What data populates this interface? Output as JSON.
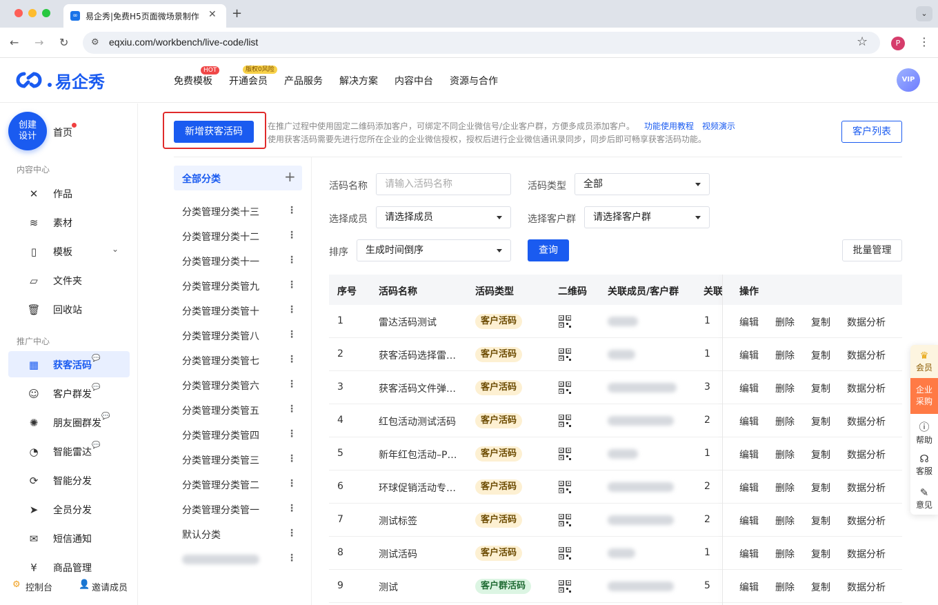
{
  "browser": {
    "tab_title": "易企秀|免费H5页面微场景制作",
    "tab_favicon": "∞",
    "url": "eqxiu.com/workbench/live-code/list",
    "profile_initial": "P"
  },
  "header": {
    "logo_text": "易企秀",
    "nav": [
      {
        "label": "免费模板",
        "badge": "HOT"
      },
      {
        "label": "开通会员",
        "badge": "版权0风险"
      },
      {
        "label": "产品服务",
        "badge": ""
      },
      {
        "label": "解决方案",
        "badge": ""
      },
      {
        "label": "内容中台",
        "badge": ""
      },
      {
        "label": "资源与合作",
        "badge": ""
      }
    ],
    "vip_label": "VIP"
  },
  "sidebar": {
    "create_label_1": "创建",
    "create_label_2": "设计",
    "home": "首页",
    "content_center": "内容中心",
    "content_items": [
      {
        "label": "作品",
        "icon": "tools-icon"
      },
      {
        "label": "素材",
        "icon": "layers-icon"
      },
      {
        "label": "模板",
        "icon": "template-icon"
      },
      {
        "label": "文件夹",
        "icon": "folder-icon"
      },
      {
        "label": "回收站",
        "icon": "trash-icon"
      }
    ],
    "promo_center": "推广中心",
    "promo_items": [
      {
        "label": "获客活码",
        "icon": "qrcode-icon",
        "new": true,
        "active": true
      },
      {
        "label": "客户群发",
        "icon": "user-broadcast-icon",
        "new": true
      },
      {
        "label": "朋友圈群发",
        "icon": "aperture-icon",
        "new": true
      },
      {
        "label": "智能雷达",
        "icon": "radar-icon",
        "new": true
      },
      {
        "label": "智能分发",
        "icon": "distribute-icon"
      },
      {
        "label": "全员分发",
        "icon": "send-icon"
      },
      {
        "label": "短信通知",
        "icon": "mail-icon"
      },
      {
        "label": "商品管理",
        "icon": "yen-icon"
      }
    ],
    "footer_console": "控制台",
    "footer_invite": "邀请成员"
  },
  "toolbar": {
    "add_button": "新增获客活码",
    "notice_line1": "在推广过程中使用固定二维码添加客户，可绑定不同企业微信号/企业客户群，方便多成员添加客户。",
    "link_tutorial": "功能使用教程",
    "link_video": "视频演示",
    "notice_line2": "使用获客活码需要先进行您所在企业的企业微信授权，授权后进行企业微信通讯录同步，同步后即可畅享获客活码功能。",
    "customer_list_button": "客户列表"
  },
  "categories": {
    "all_label": "全部分类",
    "items": [
      "分类管理分类十三",
      "分类管理分类十二",
      "分类管理分类十一",
      "分类管理分类管九",
      "分类管理分类管十",
      "分类管理分类管八",
      "分类管理分类管七",
      "分类管理分类管六",
      "分类管理分类管五",
      "分类管理分类管四",
      "分类管理分类管三",
      "分类管理分类管二",
      "分类管理分类管一",
      "默认分类"
    ]
  },
  "filters": {
    "name_label": "活码名称",
    "name_placeholder": "请输入活码名称",
    "type_label": "活码类型",
    "type_value": "全部",
    "member_label": "选择成员",
    "member_value": "请选择成员",
    "group_label": "选择客户群",
    "group_value": "请选择客户群",
    "sort_label": "排序",
    "sort_value": "生成时间倒序",
    "query_button": "查询",
    "batch_button": "批量管理"
  },
  "table": {
    "headers": [
      "序号",
      "活码名称",
      "活码类型",
      "二维码",
      "关联成员/客户群",
      "关联",
      "操作"
    ],
    "ops": [
      "编辑",
      "删除",
      "复制",
      "数据分析"
    ],
    "rows": [
      {
        "no": "1",
        "name": "雷达活码测试",
        "type": "客户活码",
        "kind": "c",
        "count": "1"
      },
      {
        "no": "2",
        "name": "获客活码选择雷…",
        "type": "客户活码",
        "kind": "c",
        "count": "1"
      },
      {
        "no": "3",
        "name": "获客活码文件弹…",
        "type": "客户活码",
        "kind": "c",
        "count": "3"
      },
      {
        "no": "4",
        "name": "红包活动测试活码",
        "type": "客户活码",
        "kind": "c",
        "count": "2"
      },
      {
        "no": "5",
        "name": "新年红包活动–P…",
        "type": "客户活码",
        "kind": "c",
        "count": "1"
      },
      {
        "no": "6",
        "name": "环球促销活动专…",
        "type": "客户活码",
        "kind": "c",
        "count": "2"
      },
      {
        "no": "7",
        "name": "测试标签",
        "type": "客户活码",
        "kind": "c",
        "count": "2"
      },
      {
        "no": "8",
        "name": "测试活码",
        "type": "客户活码",
        "kind": "c",
        "count": "1"
      },
      {
        "no": "9",
        "name": "测试",
        "type": "客户群活码",
        "kind": "g",
        "count": "5"
      }
    ]
  },
  "float_bar": {
    "vip": "会员",
    "enterprise_1": "企业",
    "enterprise_2": "采购",
    "help": "帮助",
    "service": "客服",
    "feedback": "意见"
  }
}
